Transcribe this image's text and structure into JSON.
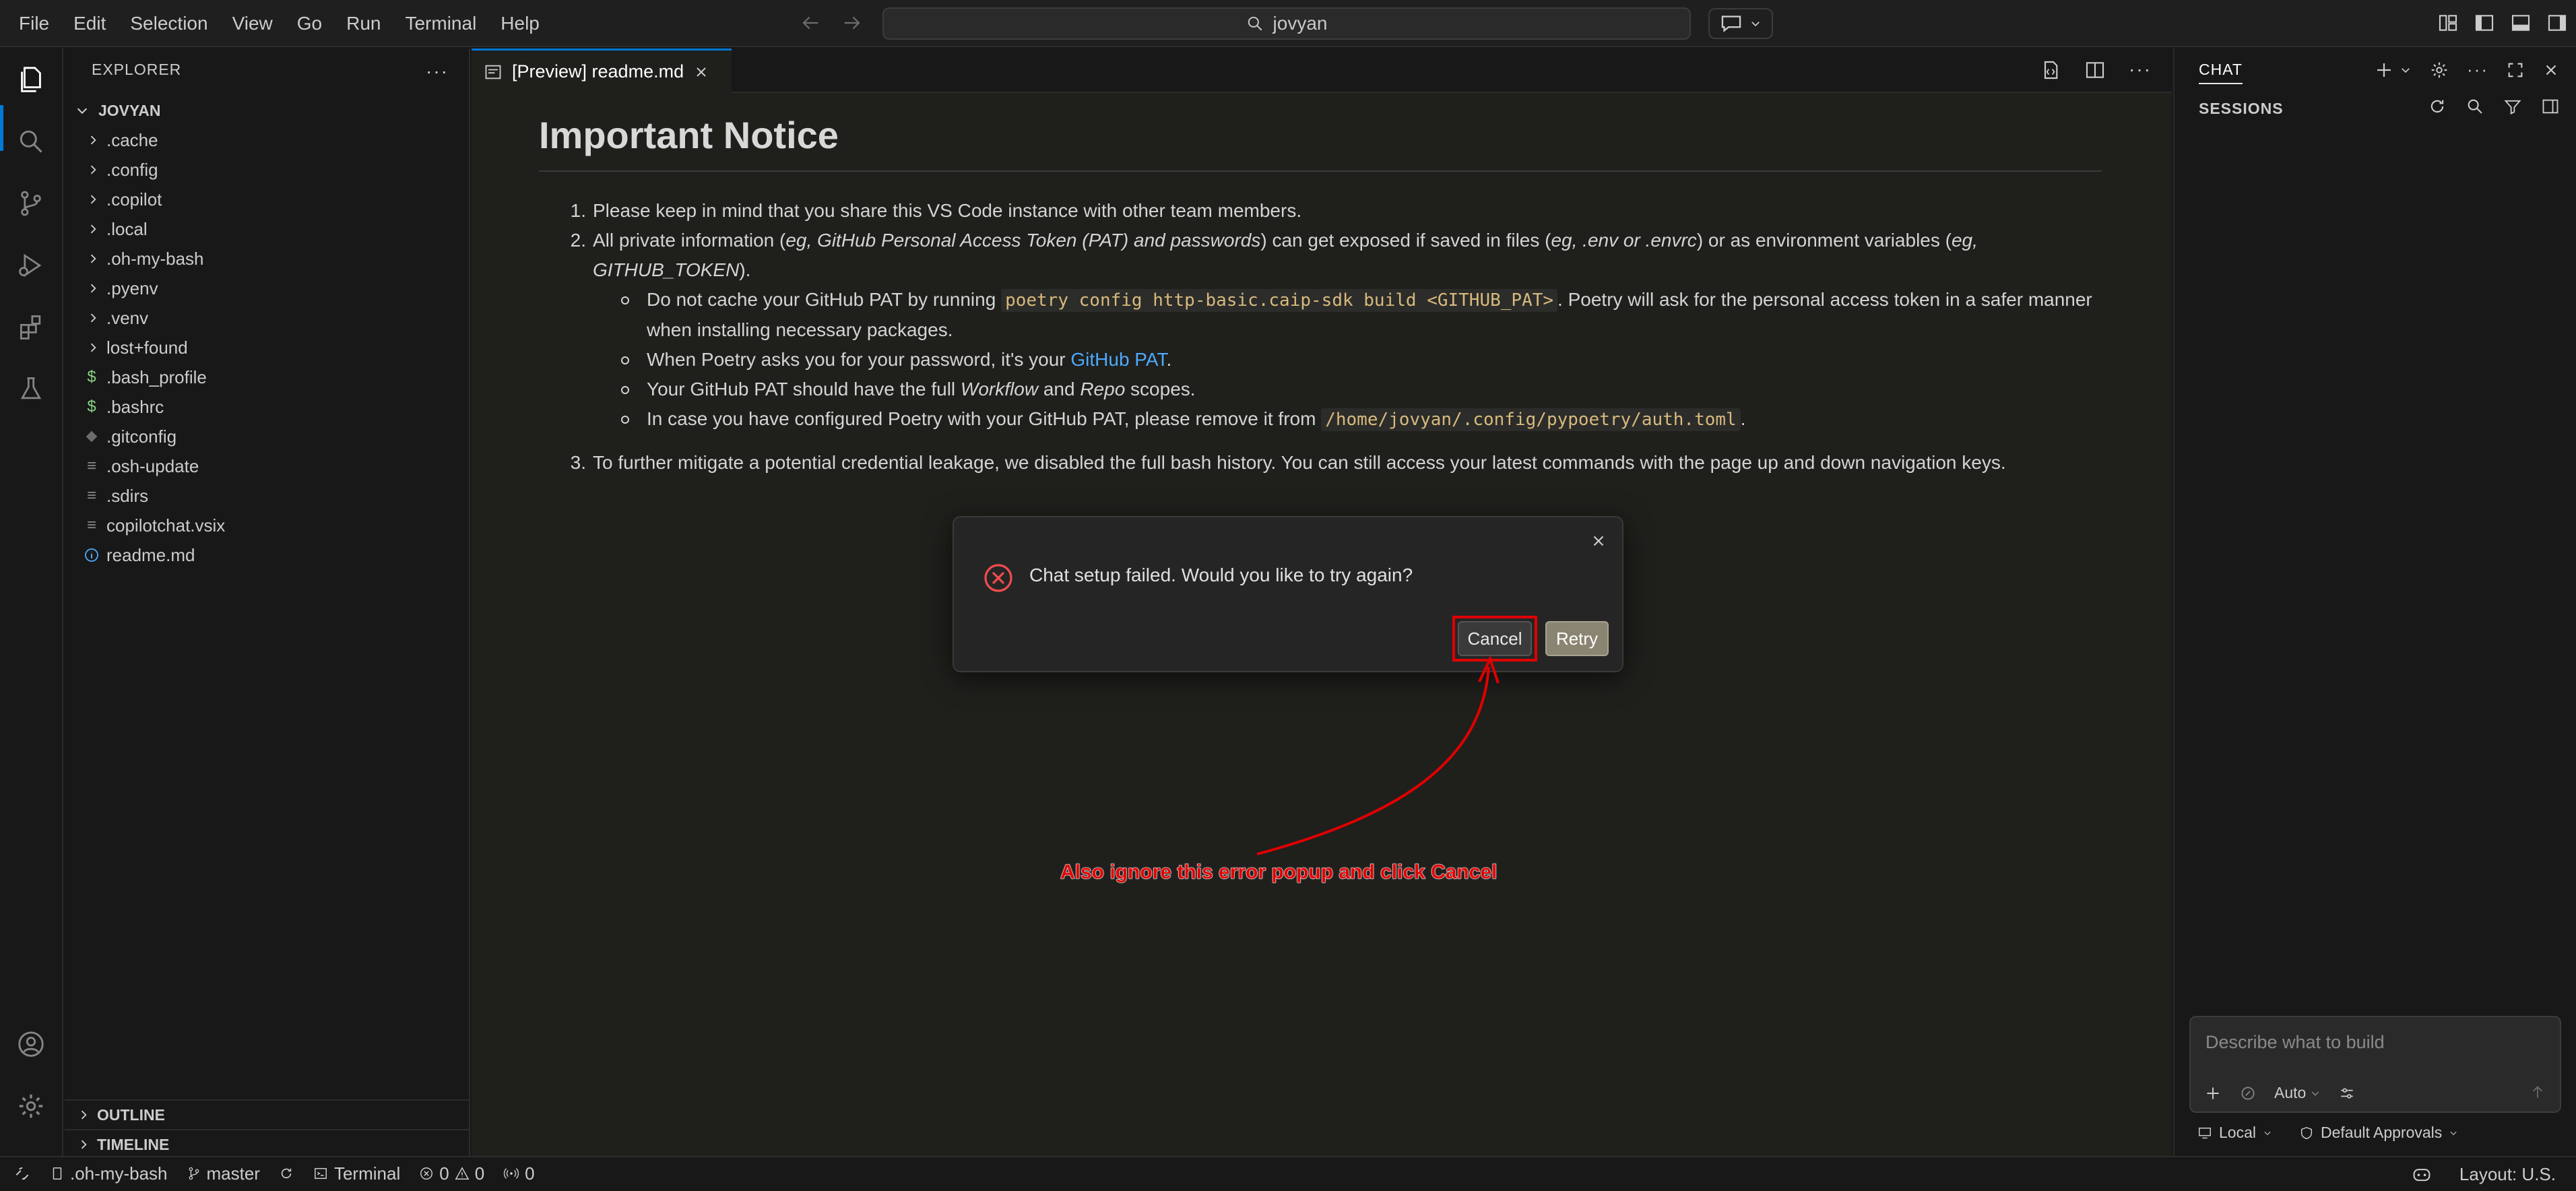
{
  "menu": [
    "File",
    "Edit",
    "Selection",
    "View",
    "Go",
    "Run",
    "Terminal",
    "Help"
  ],
  "search": {
    "text": "jovyan"
  },
  "sidebar": {
    "title": "EXPLORER",
    "root": "JOVYAN",
    "items": [
      {
        "label": ".cache",
        "kind": "folder"
      },
      {
        "label": ".config",
        "kind": "folder"
      },
      {
        "label": ".copilot",
        "kind": "folder"
      },
      {
        "label": ".local",
        "kind": "folder"
      },
      {
        "label": ".oh-my-bash",
        "kind": "folder"
      },
      {
        "label": ".pyenv",
        "kind": "folder"
      },
      {
        "label": ".venv",
        "kind": "folder"
      },
      {
        "label": "lost+found",
        "kind": "folder"
      },
      {
        "label": ".bash_profile",
        "kind": "shell"
      },
      {
        "label": ".bashrc",
        "kind": "shell"
      },
      {
        "label": ".gitconfig",
        "kind": "git"
      },
      {
        "label": ".osh-update",
        "kind": "plain"
      },
      {
        "label": ".sdirs",
        "kind": "plain"
      },
      {
        "label": "copilotchat.vsix",
        "kind": "plain"
      },
      {
        "label": "readme.md",
        "kind": "info"
      }
    ],
    "outline": "OUTLINE",
    "timeline": "TIMELINE"
  },
  "editor": {
    "tab_label": "[Preview] readme.md",
    "heading": "Important Notice",
    "item1": "Please keep in mind that you share this VS Code instance with other team members.",
    "item2_a": "All private information (",
    "item2_b": "eg, GitHub Personal Access Token (PAT) and passwords",
    "item2_c": ") can get exposed if saved in files (",
    "item2_d": "eg, .env or .envrc",
    "item2_e": ") or as environment variables (",
    "item2_f": "eg, GITHUB_TOKEN",
    "item2_g": ").",
    "sub1_a": "Do not cache your GitHub PAT by running ",
    "sub1_code": "poetry config http-basic.caip-sdk build <GITHUB_PAT>",
    "sub1_b": ". Poetry will ask for the personal access token in a safer manner when installing necessary packages.",
    "sub2_a": "When Poetry asks you for your password, it's your ",
    "sub2_link": "GitHub PAT",
    "sub2_b": ".",
    "sub3_a": "Your GitHub PAT should have the full ",
    "sub3_em1": "Workflow",
    "sub3_b": " and ",
    "sub3_em2": "Repo",
    "sub3_c": " scopes.",
    "sub4_a": "In case you have configured Poetry with your GitHub PAT, please remove it from ",
    "sub4_code": "/home/jovyan/.config/pypoetry/auth.toml",
    "sub4_b": ".",
    "item3": "To further mitigate a potential credential leakage, we disabled the full bash history. You can still access your latest commands with the page up and down navigation keys."
  },
  "dialog": {
    "message": "Chat setup failed. Would you like to try again?",
    "cancel": "Cancel",
    "retry": "Retry"
  },
  "annotation": "Also ignore this error popup and click Cancel",
  "chat": {
    "tab": "CHAT",
    "sessions": "SESSIONS",
    "placeholder": "Describe what to build",
    "mode": "Auto",
    "location": "Local",
    "approvals": "Default Approvals"
  },
  "status": {
    "folder": ".oh-my-bash",
    "branch": "master",
    "terminal": "Terminal",
    "errors": "0",
    "warnings": "0",
    "ports": "0",
    "layout": "Layout: U.S."
  },
  "colors": {
    "accent": "#0078d4",
    "annotation": "#e00000",
    "link": "#4daafc"
  }
}
